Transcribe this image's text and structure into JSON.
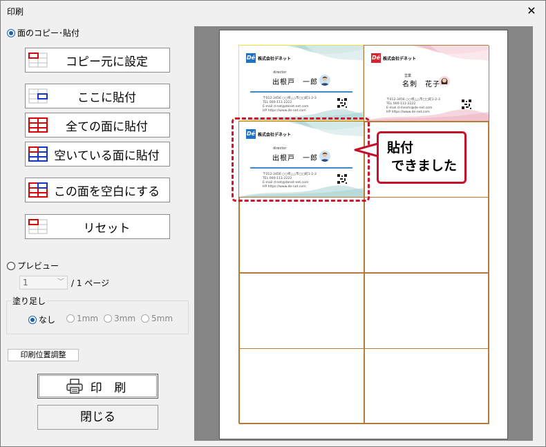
{
  "window": {
    "title": "印刷",
    "close_glyph": "✕"
  },
  "modes": {
    "copy_paste": "面のコピー･貼付",
    "preview": "プレビュー"
  },
  "buttons": {
    "copy_source": "コピー元に設定",
    "paste_here": "ここに貼付",
    "paste_all": "全ての面に貼付",
    "paste_empty": "空いている面に貼付",
    "make_blank": "この面を空白にする",
    "reset": "リセット",
    "print_position": "印刷位置調整",
    "print": "印 刷",
    "close": "閉じる"
  },
  "page_select": {
    "value": "1",
    "suffix": "/ 1 ページ"
  },
  "bleed": {
    "legend": "塗り足し",
    "options": [
      "なし",
      "1mm",
      "3mm",
      "5mm"
    ],
    "selected": "なし"
  },
  "cards": {
    "company": "株式会社デネット",
    "logo_text": "Dé",
    "card1": {
      "role": "director",
      "name": "出根戸　一郎",
      "addr1": "〒012-3456 ○○県△△市□□町1-2-3",
      "addr2": "TEL 000-111-2222",
      "addr3": "E-mail d-net@denet-net.com",
      "addr4": "HP https://www.de-net.com"
    },
    "card2": {
      "role": "営業",
      "name": "名刺　花子",
      "addr1": "〒012-3456 ○○県△△市□□町1-2-3",
      "addr2": "TEL 000-111-2222",
      "addr3": "E-mail d-meishi@de-net.com",
      "addr4": "HP https://www.de-net.com"
    }
  },
  "callout": {
    "line1": "貼付",
    "line2": "できました"
  },
  "colors": {
    "accent_blue": "#1a5fb4",
    "callout_red": "#c5102b",
    "grid_line": "#b5793a"
  }
}
